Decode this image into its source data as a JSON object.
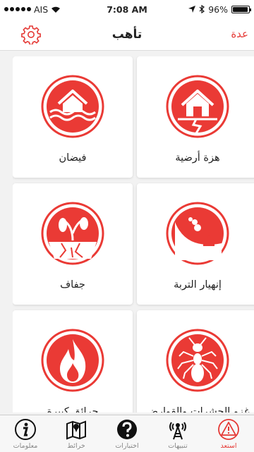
{
  "status_bar": {
    "carrier": "AIS",
    "time": "7:08 AM",
    "battery": "96%",
    "battery_level": 0.96
  },
  "nav": {
    "title": "تأهب",
    "back_label": "عدة"
  },
  "cards": [
    {
      "label": "هزة أرضية",
      "icon": "earthquake-icon"
    },
    {
      "label": "فيضان",
      "icon": "flood-icon"
    },
    {
      "label": "إنهيار التربة",
      "icon": "landslide-icon"
    },
    {
      "label": "جفاف",
      "icon": "drought-icon"
    },
    {
      "label": "غزو الحشرات والقوارض",
      "icon": "ant-icon"
    },
    {
      "label": "حرائق كبيرة",
      "icon": "fire-icon"
    }
  ],
  "tabs": [
    {
      "label": "معلومات",
      "icon": "info-icon"
    },
    {
      "label": "خرائط",
      "icon": "map-icon"
    },
    {
      "label": "اختبارات",
      "icon": "question-icon"
    },
    {
      "label": "تنبيهات",
      "icon": "alert-tower-icon"
    },
    {
      "label": "استعد",
      "icon": "warning-icon",
      "active": true
    }
  ],
  "colors": {
    "accent": "#e53935",
    "icon_red": "#ea3a35"
  }
}
